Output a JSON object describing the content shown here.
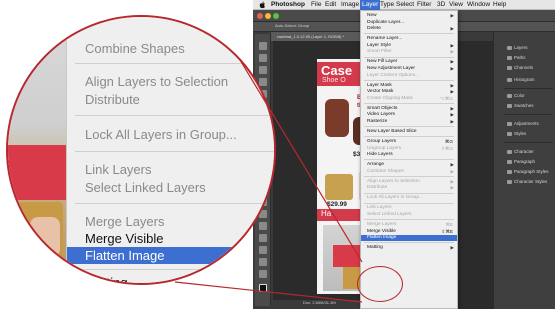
{
  "menubar": {
    "app": "Photoshop",
    "items": [
      "File",
      "Edit",
      "Image",
      "Layer",
      "Type",
      "Select",
      "Filter",
      "3D",
      "View",
      "Window",
      "Help"
    ],
    "active": "Layer"
  },
  "layer_menu": {
    "items": [
      {
        "label": "New",
        "enabled": true,
        "submenu": true
      },
      {
        "label": "Duplicate Layer...",
        "enabled": true
      },
      {
        "label": "Delete",
        "enabled": true,
        "submenu": true
      },
      {
        "label": "Rename Layer...",
        "enabled": true
      },
      {
        "label": "Layer Style",
        "enabled": true,
        "submenu": true
      },
      {
        "label": "Smart Filter",
        "enabled": false,
        "submenu": true
      },
      {
        "label": "New Fill Layer",
        "enabled": true,
        "submenu": true
      },
      {
        "label": "New Adjustment Layer",
        "enabled": true,
        "submenu": true
      },
      {
        "label": "Layer Content Options...",
        "enabled": false
      },
      {
        "label": "Layer Mask",
        "enabled": true,
        "submenu": true
      },
      {
        "label": "Vector Mask",
        "enabled": true,
        "submenu": true
      },
      {
        "label": "Create Clipping Mask",
        "enabled": false,
        "shortcut": "⌥⌘G"
      },
      {
        "label": "Smart Objects",
        "enabled": true,
        "submenu": true
      },
      {
        "label": "Video Layers",
        "enabled": true,
        "submenu": true
      },
      {
        "label": "Rasterize",
        "enabled": true,
        "submenu": true
      },
      {
        "label": "New Layer Based Slice",
        "enabled": true
      },
      {
        "label": "Group Layers",
        "enabled": true,
        "shortcut": "⌘G"
      },
      {
        "label": "Ungroup Layers",
        "enabled": false,
        "shortcut": "⇧⌘G"
      },
      {
        "label": "Hide Layers",
        "enabled": true
      },
      {
        "label": "Arrange",
        "enabled": true,
        "submenu": true
      },
      {
        "label": "Combine Shapes",
        "enabled": false,
        "submenu": true
      },
      {
        "label": "Align Layers to Selection",
        "enabled": false,
        "submenu": true
      },
      {
        "label": "Distribute",
        "enabled": false,
        "submenu": true
      },
      {
        "label": "Lock All Layers in Group...",
        "enabled": false
      },
      {
        "label": "Link Layers",
        "enabled": false
      },
      {
        "label": "Select Linked Layers",
        "enabled": false
      },
      {
        "label": "Merge Layers",
        "enabled": false,
        "shortcut": "⌘E"
      },
      {
        "label": "Merge Visible",
        "enabled": true,
        "shortcut": "⇧⌘E"
      },
      {
        "label": "Flatten Image",
        "enabled": true,
        "highlighted": true
      },
      {
        "label": "Matting",
        "enabled": true,
        "submenu": true
      }
    ]
  },
  "zoom": {
    "items": [
      {
        "label": "Combine Shapes",
        "enabled": false
      },
      {
        "label": "Align Layers to Selection",
        "enabled": false
      },
      {
        "label": "Distribute",
        "enabled": false
      },
      {
        "label": "Lock All Layers in Group...",
        "enabled": false
      },
      {
        "label": "Link Layers",
        "enabled": false
      },
      {
        "label": "Select Linked Layers",
        "enabled": false
      },
      {
        "label": "Merge Layers",
        "enabled": false
      },
      {
        "label": "Merge Visible",
        "enabled": true
      },
      {
        "label": "Flatten Image",
        "enabled": true,
        "highlighted": true
      },
      {
        "label": "Matting",
        "enabled": true
      }
    ]
  },
  "canvas": {
    "banner_title": "Case",
    "banner_sub": "Shoe O",
    "price1": "$39.5",
    "price2": "$29.99",
    "band_text": "Ha",
    "callout": "Be",
    "callout2": "th"
  },
  "doc_tab": "rawbhat_1.0.12.05 (Layer 1, RGB/8) *",
  "options_bar": "Auto-Select:  Group",
  "status": "Doc: 2.65M/31.3M",
  "panels": {
    "items": [
      "Layers",
      "Paths",
      "Channels",
      "Histogram",
      "Color",
      "Swatches",
      "Adjustments",
      "Styles",
      "Character",
      "Paragraph",
      "Paragraph Styles",
      "Character Styles"
    ]
  },
  "colors": {
    "highlight": "#3d6fd0",
    "callout": "#b7282e",
    "banner": "#d33a4b"
  }
}
